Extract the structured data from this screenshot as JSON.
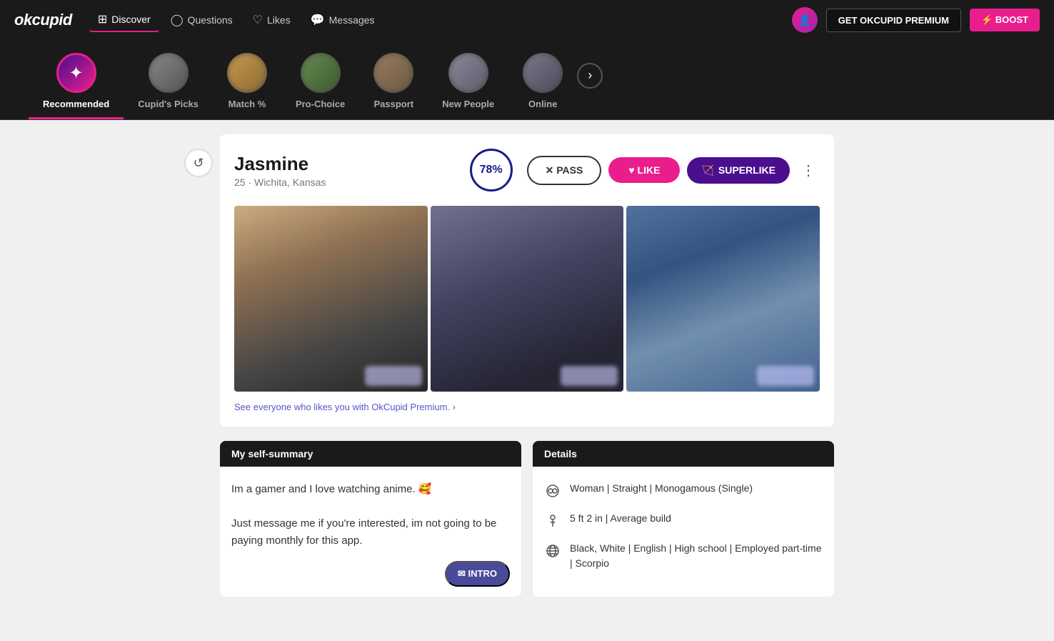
{
  "app": {
    "logo": "okcupid",
    "nav": [
      {
        "id": "discover",
        "label": "Discover",
        "icon": "⊞",
        "active": true
      },
      {
        "id": "questions",
        "label": "Questions",
        "icon": "◯"
      },
      {
        "id": "likes",
        "label": "Likes",
        "icon": "♡"
      },
      {
        "id": "messages",
        "label": "Messages",
        "icon": "💬"
      }
    ],
    "btn_premium": "GET OKCUPID PREMIUM",
    "btn_boost": "⚡ BOOST"
  },
  "categories": [
    {
      "id": "recommended",
      "label": "Recommended",
      "active": true,
      "type": "icon"
    },
    {
      "id": "cupids-picks",
      "label": "Cupid's Picks",
      "active": false,
      "type": "photo"
    },
    {
      "id": "match",
      "label": "Match %",
      "active": false,
      "type": "photo"
    },
    {
      "id": "pro-choice",
      "label": "Pro-Choice",
      "active": false,
      "type": "photo"
    },
    {
      "id": "passport",
      "label": "Passport",
      "active": false,
      "type": "photo"
    },
    {
      "id": "new-people",
      "label": "New People",
      "active": false,
      "type": "photo"
    },
    {
      "id": "online",
      "label": "Online",
      "active": false,
      "type": "photo"
    }
  ],
  "profile": {
    "name": "Jasmine",
    "age": 25,
    "location": "Wichita, Kansas",
    "match_percent": "78%",
    "btn_pass": "✕ PASS",
    "btn_like": "♥ LIKE",
    "btn_superlike": "SUPERLIKE",
    "premium_link": "See everyone who likes you with OkCupid Premium. ›",
    "self_summary": {
      "header": "My self-summary",
      "text_1": "Im a gamer and I love watching anime. 🥰",
      "text_2": "Just message me if you're interested, im not going to be paying monthly for this app.",
      "intro_btn": "✉ INTRO"
    },
    "details": {
      "header": "Details",
      "items": [
        {
          "icon": "orientation",
          "text": "Woman | Straight | Monogamous (Single)"
        },
        {
          "icon": "height",
          "text": "5 ft 2 in | Average build"
        },
        {
          "icon": "globe",
          "text": "Black, White | English | High school | Employed part-time | Scorpio"
        }
      ]
    }
  }
}
